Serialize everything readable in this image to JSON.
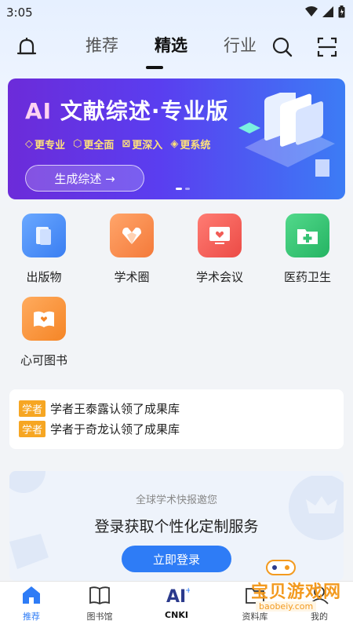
{
  "status_bar": {
    "time": "3:05"
  },
  "header": {
    "tabs": [
      {
        "label": "推荐"
      },
      {
        "label": "精选"
      },
      {
        "label": "行业"
      }
    ],
    "active_tab": "精选"
  },
  "banner": {
    "title_ai": "AI",
    "title_rest": " 文献综述·专业版",
    "features": [
      "更专业",
      "更全面",
      "更深入",
      "更系统"
    ],
    "button": "生成综述 →"
  },
  "grid": {
    "items": [
      {
        "label": "出版物",
        "icon": "book-icon",
        "color": "#4f8ff7"
      },
      {
        "label": "学术圈",
        "icon": "heart-hands-icon",
        "color": "#f58a4b"
      },
      {
        "label": "学术会议",
        "icon": "monitor-heart-icon",
        "color": "#f15c56"
      },
      {
        "label": "医药卫生",
        "icon": "medkit-icon",
        "color": "#35c273"
      },
      {
        "label": "心可图书",
        "icon": "open-book-heart-icon",
        "color": "#f7913a"
      }
    ]
  },
  "news": {
    "items": [
      {
        "tag": "学者",
        "text": "学者王泰露认领了成果库"
      },
      {
        "tag": "学者",
        "text": "学者于奇龙认领了成果库"
      }
    ]
  },
  "login": {
    "subtitle": "全球学术快报邀您",
    "title": "登录获取个性化定制服务",
    "button": "立即登录"
  },
  "bottom_nav": {
    "items": [
      {
        "label": "推荐",
        "icon": "home-icon"
      },
      {
        "label": "图书馆",
        "icon": "library-icon"
      },
      {
        "label": "CNKI",
        "icon": "ai-icon"
      },
      {
        "label": "资料库",
        "icon": "folder-icon"
      },
      {
        "label": "我的",
        "icon": "user-icon"
      }
    ]
  },
  "watermark": {
    "text": "宝贝游戏网",
    "url": "baobeiy.com"
  },
  "colors": {
    "accent": "#2e7cf6",
    "tag": "#f6a623"
  }
}
